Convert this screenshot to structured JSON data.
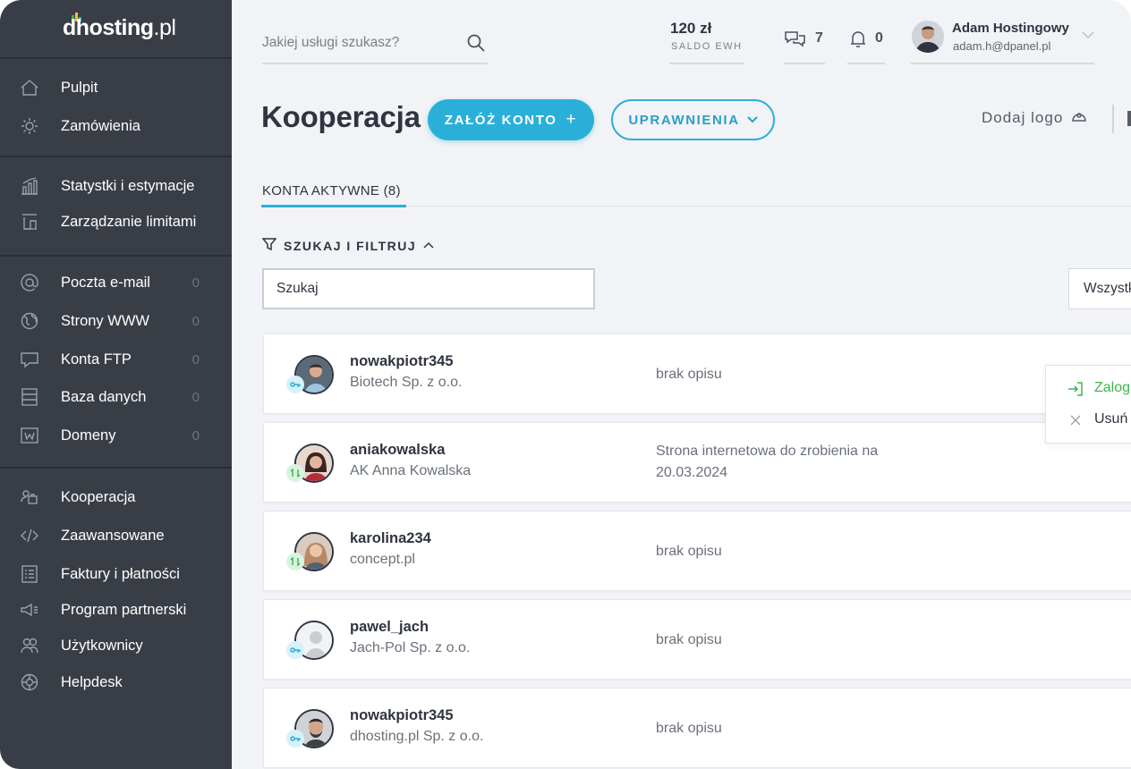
{
  "brand": {
    "name_bold": "dhosting",
    "name_light": ".pl"
  },
  "colors": {
    "accent": "#2ab0d8",
    "sidebar": "#393e46",
    "success": "#3cb64a",
    "background": "#f1f3f6"
  },
  "sidebar": {
    "items": [
      {
        "label": "Pulpit",
        "icon": "home-icon"
      },
      {
        "label": "Zamówienia",
        "icon": "bulb-icon"
      },
      {
        "label": "Statystki i estymacje",
        "icon": "chart-icon"
      },
      {
        "label": "Zarządzanie limitami",
        "icon": "limits-icon"
      },
      {
        "label": "Poczta e-mail",
        "icon": "at-icon",
        "count": "0"
      },
      {
        "label": "Strony WWW",
        "icon": "globe-icon",
        "count": "0"
      },
      {
        "label": "Konta FTP",
        "icon": "folder-icon",
        "count": "0"
      },
      {
        "label": "Baza danych",
        "icon": "database-icon",
        "count": "0"
      },
      {
        "label": "Domeny",
        "icon": "domain-icon",
        "count": "0"
      },
      {
        "label": "Kooperacja",
        "icon": "cooperation-icon"
      },
      {
        "label": "Zaawansowane",
        "icon": "code-icon"
      },
      {
        "label": "Faktury i płatności",
        "icon": "invoice-icon"
      },
      {
        "label": "Program partnerski",
        "icon": "megaphone-icon"
      },
      {
        "label": "Użytkownicy",
        "icon": "users-icon"
      },
      {
        "label": "Helpdesk",
        "icon": "lifebuoy-icon"
      }
    ]
  },
  "topbar": {
    "search_placeholder": "Jakiej usługi szukasz?",
    "balance": {
      "amount": "120 zł",
      "label": "SALDO EWH"
    },
    "messages_count": "7",
    "notifications_count": "0",
    "user": {
      "name": "Adam Hostingowy",
      "email": "adam.h@dpanel.pl"
    }
  },
  "header": {
    "title": "Kooperacja",
    "create_button": "ZAŁÓŻ KONTO",
    "permissions_button": "UPRAWNIENIA",
    "add_logo": "Dodaj logo"
  },
  "tabs": {
    "active": "KONTA AKTYWNE (8)"
  },
  "filter": {
    "toggle_label": "SZUKAJ I FILTRUJ",
    "search_placeholder": "Szukaj",
    "select_value": "Wszystkie"
  },
  "accounts": [
    {
      "login": "nowakpiotr345",
      "company": "Biotech Sp. z o.o.",
      "description": "brak opisu",
      "badge": "key-icon"
    },
    {
      "login": "aniakowalska",
      "company": "AK Anna Kowalska",
      "description": "Strona internetowa do zrobienia na 20.03.2024",
      "badge": "swap-icon"
    },
    {
      "login": "karolina234",
      "company": "concept.pl",
      "description": "brak opisu",
      "badge": "swap-icon"
    },
    {
      "login": "pawel_jach",
      "company": "Jach-Pol Sp. z o.o.",
      "description": "brak opisu",
      "badge": "key-icon"
    },
    {
      "login": "nowakpiotr345",
      "company": "dhosting.pl Sp. z o.o.",
      "description": "brak opisu",
      "badge": "key-icon"
    }
  ],
  "context_menu": {
    "login": "Zaloguj",
    "delete": "Usuń"
  }
}
